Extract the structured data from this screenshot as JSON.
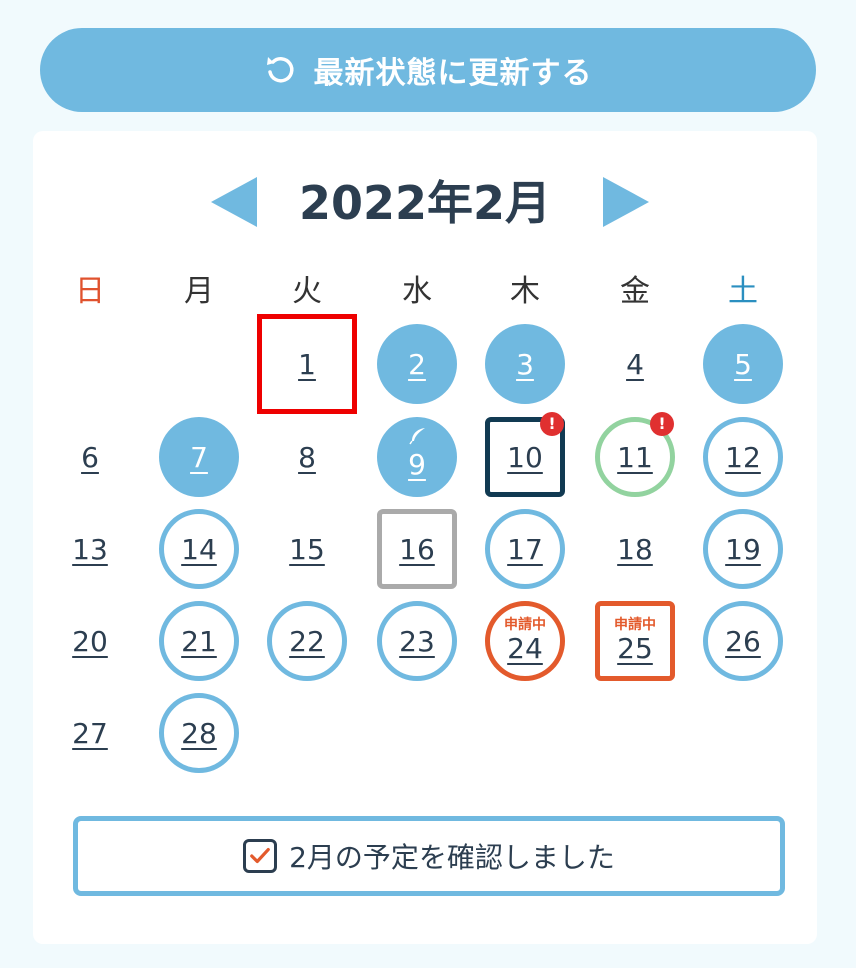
{
  "refresh": {
    "label": "最新状態に更新する",
    "icon": "refresh-icon"
  },
  "calendar": {
    "title": "2022年2月",
    "prev_icon": "chevron-left-icon",
    "next_icon": "chevron-right-icon",
    "weekdays": [
      "日",
      "月",
      "火",
      "水",
      "木",
      "金",
      "土"
    ],
    "days": {
      "d1": "1",
      "d2": "2",
      "d3": "3",
      "d4": "4",
      "d5": "5",
      "d6": "6",
      "d7": "7",
      "d8": "8",
      "d9": "9",
      "d10": "10",
      "d11": "11",
      "d12": "12",
      "d13": "13",
      "d14": "14",
      "d15": "15",
      "d16": "16",
      "d17": "17",
      "d18": "18",
      "d19": "19",
      "d20": "20",
      "d21": "21",
      "d22": "22",
      "d23": "23",
      "d24": "24",
      "d25": "25",
      "d26": "26",
      "d27": "27",
      "d28": "28"
    },
    "status_label": "申請中",
    "alert_mark": "!"
  },
  "confirm": {
    "label": "2月の予定を確認しました",
    "checked": true
  },
  "colors": {
    "accent": "#70b9e0",
    "navy": "#113a52",
    "orange": "#e35a2c",
    "green": "#92d39f",
    "alert": "#e03030",
    "selected": "#ee0000",
    "sunday": "#e0522e",
    "saturday": "#2b8fc0"
  }
}
